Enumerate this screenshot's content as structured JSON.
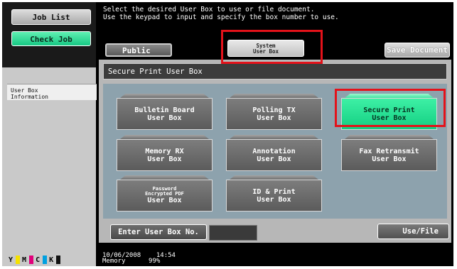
{
  "sidebar": {
    "job_list": "Job List",
    "check_job": "Check Job",
    "info_line1": "User Box",
    "info_line2": "Information",
    "toner": [
      {
        "letter": "Y",
        "color": "#f5e100"
      },
      {
        "letter": "M",
        "color": "#e0007a"
      },
      {
        "letter": "C",
        "color": "#00a0e0"
      },
      {
        "letter": "K",
        "color": "#111111"
      }
    ]
  },
  "message": {
    "line1": "Select the desired User Box to use or file document.",
    "line2": "Use the keypad to input and specify the box number to use."
  },
  "tabs": {
    "public": "Public",
    "system_line1": "System",
    "system_line2": "User Box",
    "save_document": "Save Document"
  },
  "panel": {
    "title": "Secure Print User Box",
    "boxes": [
      {
        "line1": "Bulletin Board",
        "line2": "User Box"
      },
      {
        "line1": "Polling TX",
        "line2": "User Box"
      },
      {
        "line1": "Secure Print",
        "line2": "User Box"
      },
      {
        "line1": "Memory RX",
        "line2": "User Box"
      },
      {
        "line1": "Annotation",
        "line2": "User Box"
      },
      {
        "line1": "Fax Retransmit",
        "line2": "User Box"
      },
      {
        "line1": "Password",
        "line1b": "Encrypted PDF",
        "line2": "User Box"
      },
      {
        "line1": "ID & Print",
        "line2": "User Box"
      }
    ],
    "enter_box_label": "Enter User Box No.",
    "use_file": "Use/File"
  },
  "status": {
    "date": "10/06/2008",
    "time": "14:54",
    "memory_label": "Memory",
    "memory_value": "99%"
  },
  "colors": {
    "accent_green": "#17c884",
    "highlight_red": "#e4121a"
  }
}
